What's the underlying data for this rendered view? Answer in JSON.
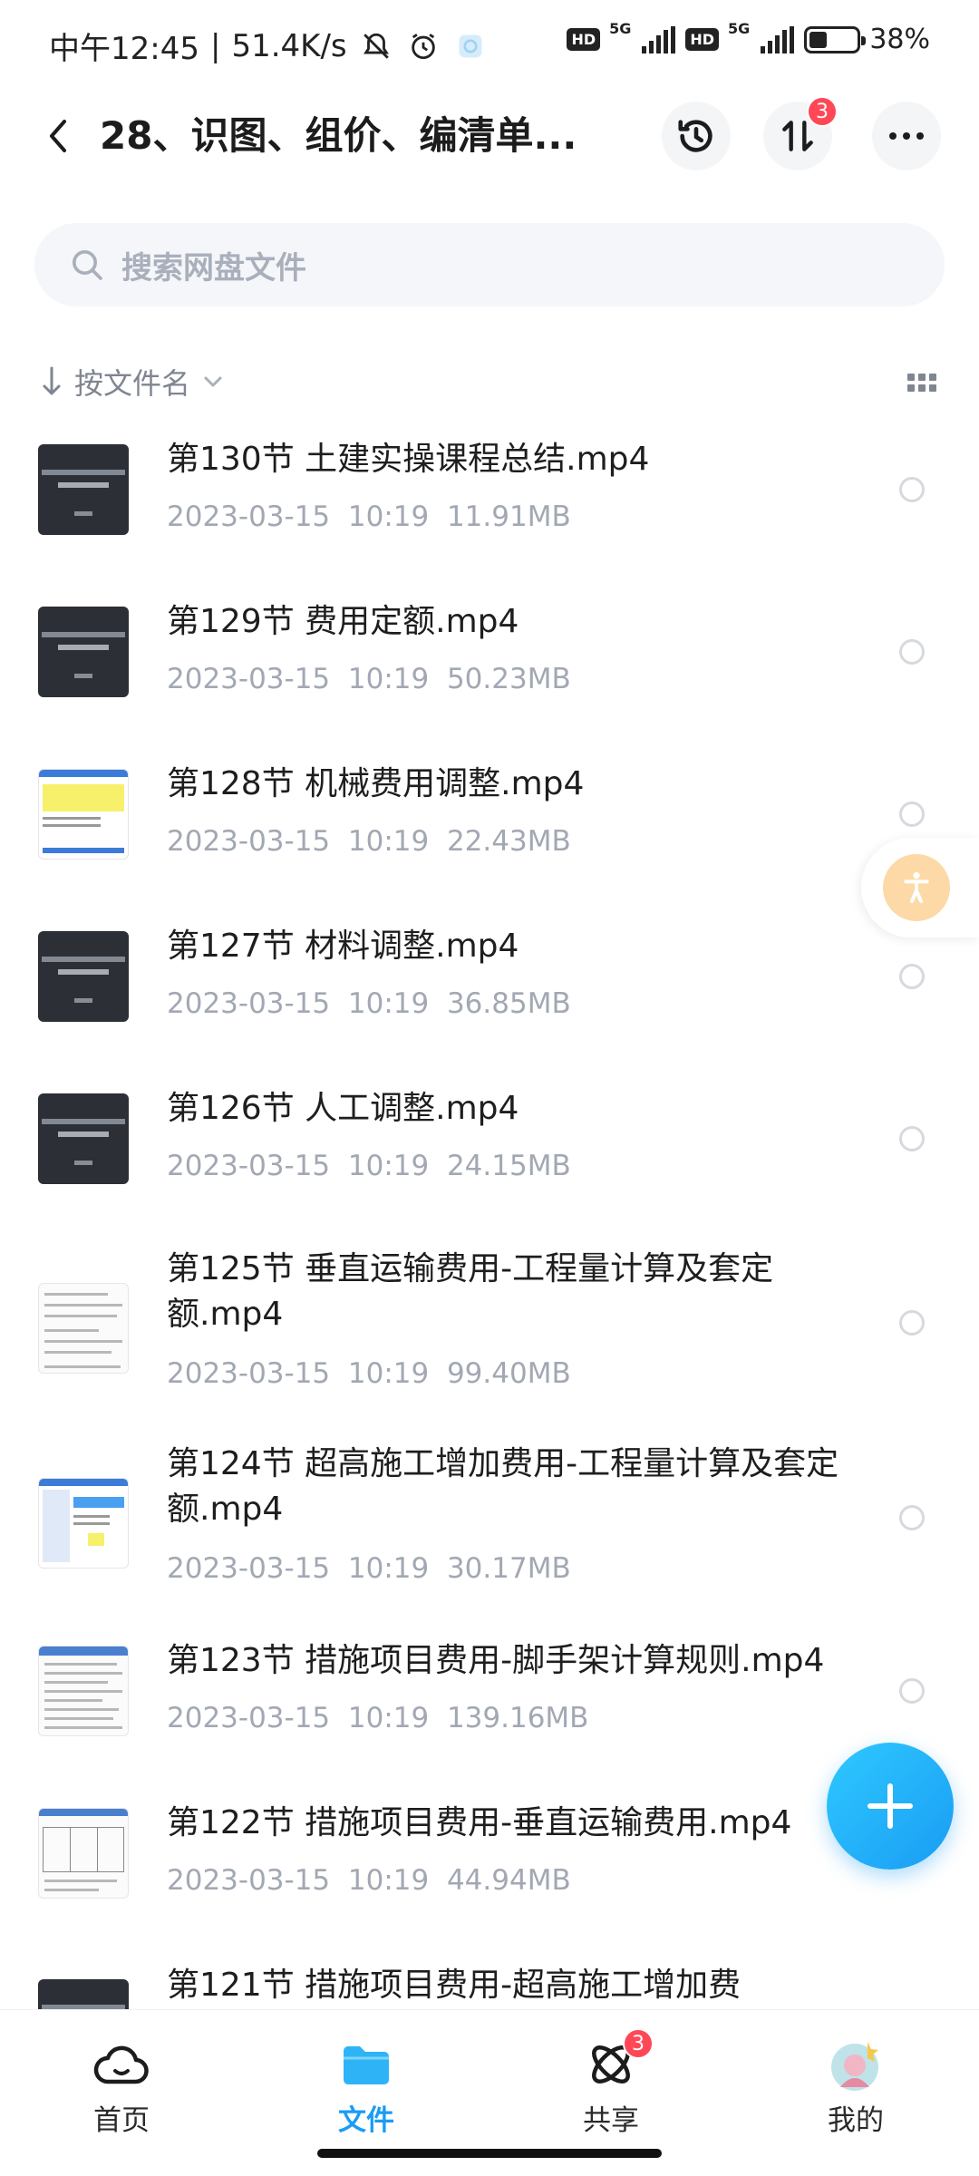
{
  "status_bar": {
    "time": "中午12:45",
    "net_speed": "51.4K/s",
    "hd1": "HD",
    "sig1": "5G",
    "hd2": "HD",
    "sig2": "5G",
    "battery": "38%",
    "battery_level": 0.38
  },
  "header": {
    "title": "28、识图、组价、编清单...",
    "transfer_badge": "3"
  },
  "search": {
    "placeholder": "搜索网盘文件"
  },
  "sort": {
    "label": "按文件名"
  },
  "files": [
    {
      "name": "第130节 土建实操课程总结.mp4",
      "date": "2023-03-15",
      "time": "10:19",
      "size": "11.91MB",
      "thumb": "dark"
    },
    {
      "name": "第129节 费用定额.mp4",
      "date": "2023-03-15",
      "time": "10:19",
      "size": "50.23MB",
      "thumb": "dark"
    },
    {
      "name": "第128节 机械费用调整.mp4",
      "date": "2023-03-15",
      "time": "10:19",
      "size": "22.43MB",
      "thumb": "sheet-yellow"
    },
    {
      "name": "第127节 材料调整.mp4",
      "date": "2023-03-15",
      "time": "10:19",
      "size": "36.85MB",
      "thumb": "dark"
    },
    {
      "name": "第126节 人工调整.mp4",
      "date": "2023-03-15",
      "time": "10:19",
      "size": "24.15MB",
      "thumb": "dark"
    },
    {
      "name": "第125节 垂直运输费用-工程量计算及套定额.mp4",
      "date": "2023-03-15",
      "time": "10:19",
      "size": "99.40MB",
      "thumb": "doc"
    },
    {
      "name": "第124节 超高施工增加费用-工程量计算及套定额.mp4",
      "date": "2023-03-15",
      "time": "10:19",
      "size": "30.17MB",
      "thumb": "sheet-blue"
    },
    {
      "name": "第123节 措施项目费用-脚手架计算规则.mp4",
      "date": "2023-03-15",
      "time": "10:19",
      "size": "139.16MB",
      "thumb": "doc"
    },
    {
      "name": "第122节 措施项目费用-垂直运输费用.mp4",
      "date": "2023-03-15",
      "time": "10:19",
      "size": "44.94MB",
      "thumb": "doc"
    },
    {
      "name": "第121节 措施项目费用-超高施工增加费",
      "date": "",
      "time": "",
      "size": "",
      "thumb": "dark"
    }
  ],
  "bottom_nav": {
    "home": "首页",
    "files": "文件",
    "share": "共享",
    "share_badge": "3",
    "mine": "我的"
  },
  "colors": {
    "accent": "#1a9cf4",
    "badge": "#ff4756",
    "meta": "#a2a8b3"
  }
}
